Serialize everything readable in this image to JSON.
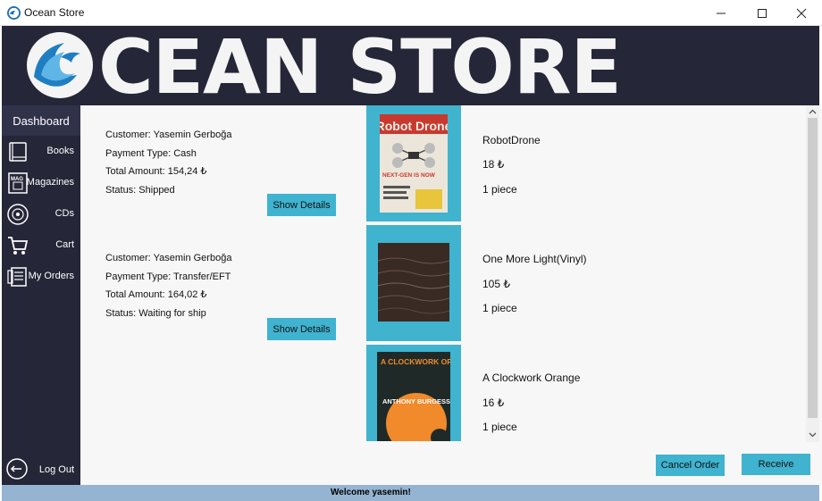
{
  "window": {
    "title": "Ocean Store",
    "icon": "ocean-wave-icon",
    "controls": [
      "minimize-icon",
      "maximize-icon",
      "close-icon"
    ]
  },
  "banner": {
    "logo_text": "CEAN STORE",
    "logo_icon": "ocean-wave-logo",
    "background": "#252637"
  },
  "sidebar": {
    "header": "Dashboard",
    "items": [
      {
        "label": "Books",
        "icon": "book-icon"
      },
      {
        "label": "Magazines",
        "icon": "magazine-icon"
      },
      {
        "label": "CDs",
        "icon": "cd-icon"
      },
      {
        "label": "Cart",
        "icon": "cart-icon"
      },
      {
        "label": "My Orders",
        "icon": "orders-icon"
      }
    ],
    "logout": {
      "label": "Log Out",
      "icon": "logout-icon"
    }
  },
  "orders": [
    {
      "customer": "Customer: Yasemin Gerboğa",
      "payment": "Payment Type: Cash",
      "total": "Total Amount: 154,24 ₺",
      "status": "Status: Shipped",
      "details_label": "Show Details"
    },
    {
      "customer": "Customer: Yasemin Gerboğa",
      "payment": "Payment Type: Transfer/EFT",
      "total": "Total Amount: 164,02 ₺",
      "status": "Status: Waiting for ship",
      "details_label": "Show Details"
    }
  ],
  "products": [
    {
      "name": "RobotDrone",
      "price": "18 ₺",
      "quantity": "1 piece",
      "cover_title": "Robot Drone",
      "cover_subtitle": "NEXT-GEN IS NOW"
    },
    {
      "name": "One More Light(Vinyl)",
      "price": "105 ₺",
      "quantity": "1 piece"
    },
    {
      "name": "A Clockwork Orange",
      "price": "16 ₺",
      "quantity": "1 piece",
      "cover_title": "A CLOCKWORK ORANGE",
      "cover_author": "ANTHONY BURGESS"
    }
  ],
  "actions": {
    "cancel": "Cancel Order",
    "receive": "Receive"
  },
  "status_bar": {
    "text": "Welcome yasemin!"
  },
  "colors": {
    "accent": "#3fb3cf",
    "dark": "#252637",
    "status_bar": "#95b4d1"
  }
}
